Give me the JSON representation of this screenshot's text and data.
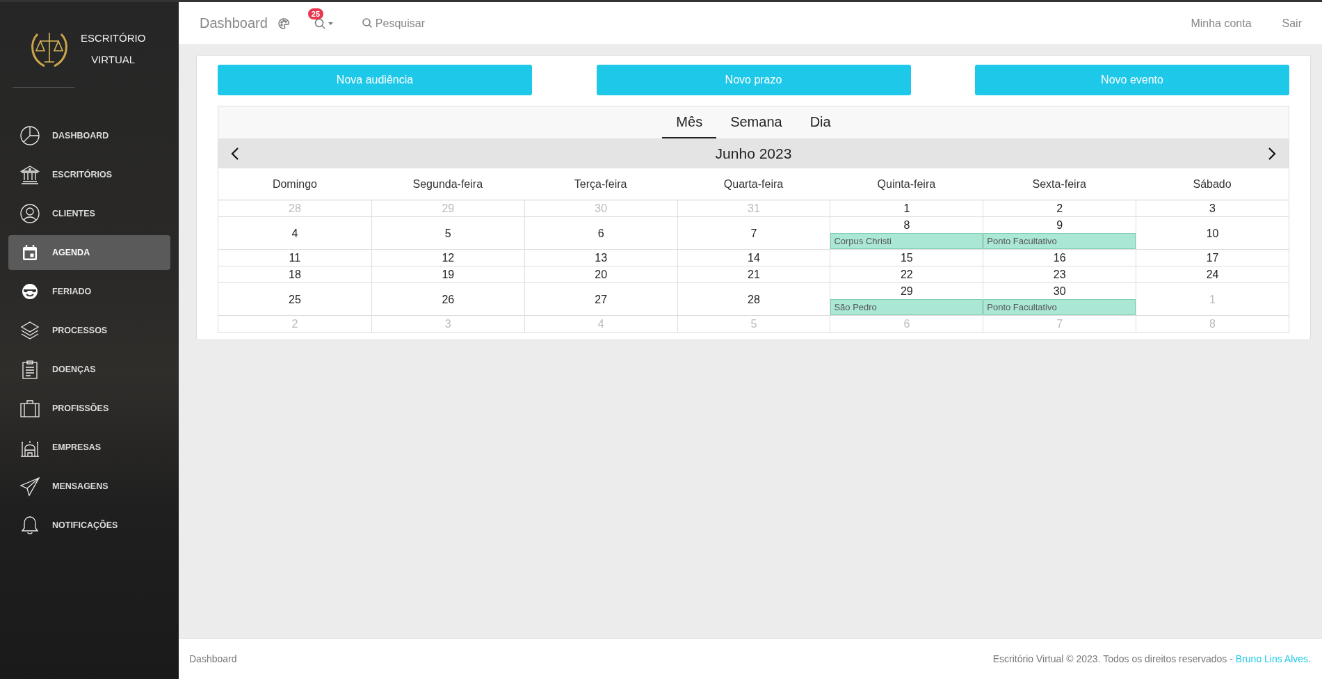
{
  "sidebar": {
    "brand": [
      "ESCRITÓRIO",
      "VIRTUAL"
    ],
    "items": [
      {
        "label": "DASHBOARD",
        "kind": "pie",
        "selected": false
      },
      {
        "label": "ESCRITÓRIOS",
        "kind": "bank",
        "selected": false
      },
      {
        "label": "CLIENTES",
        "kind": "user",
        "selected": false
      },
      {
        "label": "AGENDA",
        "kind": "calendar",
        "selected": true
      },
      {
        "label": "FERIADO",
        "kind": "smiley",
        "selected": false
      },
      {
        "label": "PROCESSOS",
        "kind": "layers",
        "selected": false
      },
      {
        "label": "DOENÇAS",
        "kind": "clipboard",
        "selected": false
      },
      {
        "label": "PROFISSÕES",
        "kind": "briefcase",
        "selected": false
      },
      {
        "label": "EMPRESAS",
        "kind": "building",
        "selected": false
      },
      {
        "label": "MENSAGENS",
        "kind": "plane",
        "selected": false
      },
      {
        "label": "NOTIFICAÇÕES",
        "kind": "bell",
        "selected": false
      }
    ]
  },
  "header": {
    "title": "Dashboard",
    "notification_count": "25",
    "search": "Pesquisar",
    "links": [
      "Minha conta",
      "Sair"
    ]
  },
  "actions": [
    "Nova audiência",
    "Novo prazo",
    "Novo evento"
  ],
  "calendar": {
    "views": [
      {
        "label": "Mês",
        "selected": true
      },
      {
        "label": "Semana",
        "selected": false
      },
      {
        "label": "Dia",
        "selected": false
      }
    ],
    "title": "Junho 2023",
    "weekdays": [
      "Domingo",
      "Segunda-feira",
      "Terça-feira",
      "Quarta-feira",
      "Quinta-feira",
      "Sexta-feira",
      "Sábado"
    ],
    "weeks": [
      [
        {
          "day": "28",
          "outside": true
        },
        {
          "day": "29",
          "outside": true
        },
        {
          "day": "30",
          "outside": true
        },
        {
          "day": "31",
          "outside": true
        },
        {
          "day": "1",
          "outside": false
        },
        {
          "day": "2",
          "outside": false
        },
        {
          "day": "3",
          "outside": false
        }
      ],
      [
        {
          "day": "4",
          "outside": false
        },
        {
          "day": "5",
          "outside": false
        },
        {
          "day": "6",
          "outside": false
        },
        {
          "day": "7",
          "outside": false
        },
        {
          "day": "8",
          "outside": false,
          "events": [
            "Corpus Christi"
          ]
        },
        {
          "day": "9",
          "outside": false,
          "events": [
            "Ponto Facultativo"
          ]
        },
        {
          "day": "10",
          "outside": false
        }
      ],
      [
        {
          "day": "11",
          "outside": false
        },
        {
          "day": "12",
          "outside": false
        },
        {
          "day": "13",
          "outside": false
        },
        {
          "day": "14",
          "outside": false
        },
        {
          "day": "15",
          "outside": false
        },
        {
          "day": "16",
          "outside": false
        },
        {
          "day": "17",
          "outside": false
        }
      ],
      [
        {
          "day": "18",
          "outside": false
        },
        {
          "day": "19",
          "outside": false
        },
        {
          "day": "20",
          "outside": false
        },
        {
          "day": "21",
          "outside": false
        },
        {
          "day": "22",
          "outside": false
        },
        {
          "day": "23",
          "outside": false
        },
        {
          "day": "24",
          "outside": false
        }
      ],
      [
        {
          "day": "25",
          "outside": false
        },
        {
          "day": "26",
          "outside": false
        },
        {
          "day": "27",
          "outside": false
        },
        {
          "day": "28",
          "outside": false
        },
        {
          "day": "29",
          "outside": false,
          "events": [
            "São Pedro"
          ]
        },
        {
          "day": "30",
          "outside": false,
          "events": [
            "Ponto Facultativo"
          ]
        },
        {
          "day": "1",
          "outside": true
        }
      ],
      [
        {
          "day": "2",
          "outside": true
        },
        {
          "day": "3",
          "outside": true
        },
        {
          "day": "4",
          "outside": true
        },
        {
          "day": "5",
          "outside": true
        },
        {
          "day": "6",
          "outside": true
        },
        {
          "day": "7",
          "outside": true
        },
        {
          "day": "8",
          "outside": true
        }
      ]
    ]
  },
  "footer": {
    "left": "Dashboard",
    "copyright": "Escritório Virtual © 2023. Todos os direitos reservados - ",
    "author": "Bruno Lins Alves",
    "end": "."
  }
}
